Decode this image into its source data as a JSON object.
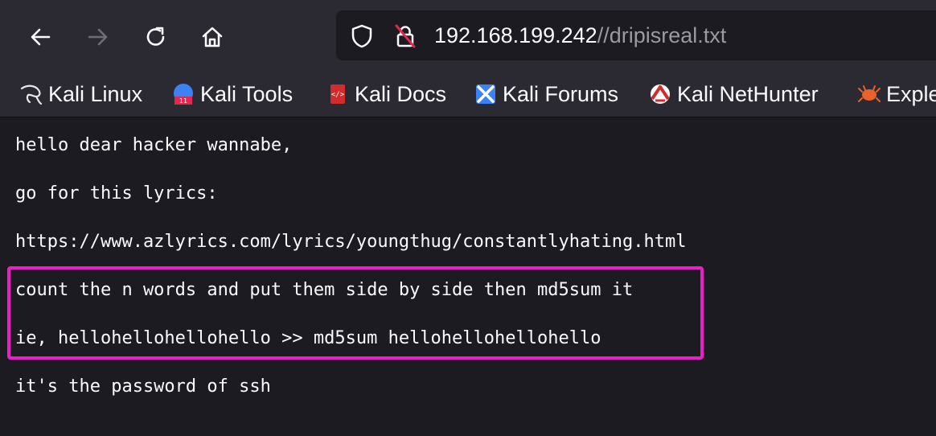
{
  "toolbar": {
    "back_icon": "arrow-left-icon",
    "forward_icon": "arrow-right-icon",
    "reload_icon": "reload-icon",
    "home_icon": "home-icon"
  },
  "urlbar": {
    "shield_icon": "shield-icon",
    "lock_icon": "insecure-lock-icon",
    "host": "192.168.199.242",
    "path": "//dripisreal.txt"
  },
  "bookmarks": [
    {
      "label": "Kali Linux",
      "icon": "kali-dragon-icon"
    },
    {
      "label": "Kali Tools",
      "icon": "kali-tools-icon"
    },
    {
      "label": "Kali Docs",
      "icon": "kali-docs-icon"
    },
    {
      "label": "Kali Forums",
      "icon": "kali-forums-icon"
    },
    {
      "label": "Kali NetHunter",
      "icon": "kali-nethunter-icon"
    },
    {
      "label": "Exple",
      "icon": "exploit-db-icon"
    }
  ],
  "content": {
    "lines": [
      "hello dear hacker wannabe,",
      "go for this lyrics:",
      "https://www.azlyrics.com/lyrics/youngthug/constantlyhating.html",
      "count the n words and put them side by side then md5sum it",
      "ie, hellohellohellohello >> md5sum hellohellohellohello",
      "it's the password of ssh"
    ]
  },
  "colors": {
    "toolbar_bg": "#2b2a33",
    "page_bg": "#1c1b22",
    "text": "#fbfbfe",
    "highlight": "#e91fc8"
  }
}
